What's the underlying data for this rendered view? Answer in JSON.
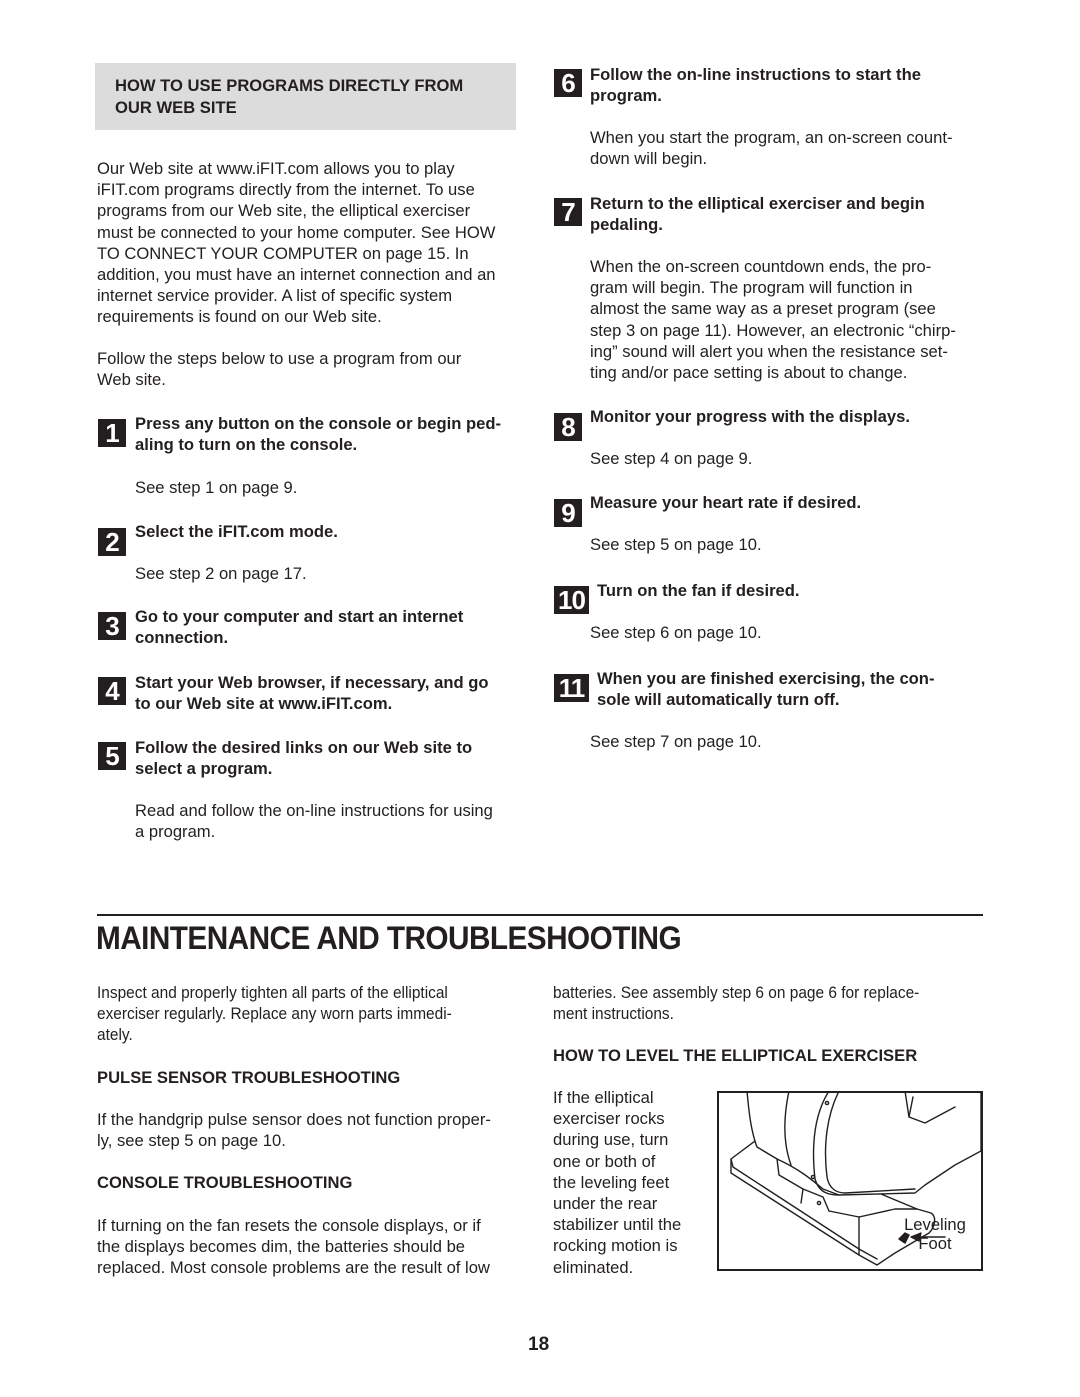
{
  "web_programs": {
    "heading_lines": [
      "HOW TO USE PROGRAMS DIRECTLY FROM",
      "OUR WEB SITE"
    ],
    "intro_lines": [
      "Our Web site at www.iFIT.com allows you to play",
      "iFIT.com programs directly from the internet. To use",
      "programs from our Web site, the elliptical exerciser",
      "must be connected to your home computer. See HOW",
      "TO CONNECT YOUR COMPUTER on page 15. In",
      "addition, you must have an internet connection and an",
      "internet service provider. A list of specific system",
      "requirements is found on our Web site."
    ],
    "follow_lines": [
      "Follow the steps below to use a program from our",
      "Web site."
    ],
    "steps": [
      {
        "number": "1",
        "title_lines": [
          "Press any button on the console or begin ped-",
          "aling to turn on the console."
        ],
        "body_lines": [
          "See step 1 on page 9."
        ]
      },
      {
        "number": "2",
        "title_lines": [
          "Select the iFIT.com mode."
        ],
        "body_lines": [
          "See step 2 on page 17."
        ]
      },
      {
        "number": "3",
        "title_lines": [
          "Go to your computer and start an internet",
          "connection."
        ],
        "body_lines": []
      },
      {
        "number": "4",
        "title_lines": [
          "Start your Web browser, if necessary, and go",
          "to our Web site at www.iFIT.com."
        ],
        "body_lines": []
      },
      {
        "number": "5",
        "title_lines": [
          "Follow the desired links on our Web site to",
          "select a program."
        ],
        "body_lines": [
          "Read and follow the on-line instructions for using",
          "a program."
        ]
      },
      {
        "number": "6",
        "title_lines": [
          "Follow the on-line instructions to start the",
          "program."
        ],
        "body_lines": [
          "When you start the program, an on-screen count-",
          "down will begin."
        ]
      },
      {
        "number": "7",
        "title_lines": [
          "Return to the elliptical exerciser and begin",
          "pedaling."
        ],
        "body_lines": [
          "When the on-screen countdown ends, the pro-",
          "gram will begin. The program will function in",
          "almost the same way as a preset program (see",
          "step 3 on page 11). However, an electronic “chirp-",
          "ing” sound will alert you when the resistance set-",
          "ting and/or pace setting is about to change."
        ]
      },
      {
        "number": "8",
        "title_lines": [
          "Monitor your progress with the displays."
        ],
        "body_lines": [
          "See step 4 on page 9."
        ]
      },
      {
        "number": "9",
        "title_lines": [
          "Measure your heart rate if desired."
        ],
        "body_lines": [
          "See step 5 on page 10."
        ]
      },
      {
        "number": "10",
        "title_lines": [
          "Turn on the fan if desired."
        ],
        "body_lines": [
          "See step 6 on page 10."
        ]
      },
      {
        "number": "11",
        "title_lines": [
          "When you are finished exercising, the con-",
          "sole will automatically turn off."
        ],
        "body_lines": [
          "See step 7 on page 10."
        ]
      }
    ]
  },
  "maintenance": {
    "title": "MAINTENANCE AND TROUBLESHOOTING",
    "intro_lines": [
      "Inspect and properly tighten all parts of the elliptical",
      "exerciser regularly. Replace any worn parts immedi-",
      "ately."
    ],
    "pulse_heading": "PULSE SENSOR TROUBLESHOOTING",
    "pulse_lines": [
      "If the handgrip pulse sensor does not function proper-",
      "ly, see step 5 on page 10."
    ],
    "console_heading": "CONSOLE TROUBLESHOOTING",
    "console_lines": [
      "If turning on the fan resets the console displays, or if",
      "the displays becomes dim, the batteries should be",
      "replaced. Most console problems are the result of low"
    ],
    "console_cont_lines": [
      "batteries. See assembly step 6 on page 6 for replace-",
      "ment instructions."
    ],
    "level_heading": "HOW TO LEVEL THE ELLIPTICAL EXERCISER",
    "level_lines": [
      "If the elliptical",
      "exerciser rocks",
      "during use, turn",
      "one or both of",
      "the leveling feet",
      "under the rear",
      "stabilizer until the",
      "rocking motion is",
      "eliminated."
    ],
    "figure_label_lines": [
      "Leveling",
      "Foot"
    ]
  },
  "page_number": "18"
}
